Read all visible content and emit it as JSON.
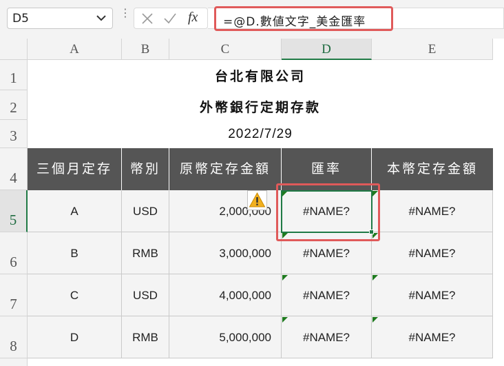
{
  "namebox": {
    "value": "D5"
  },
  "formula_bar": {
    "fx_label": "fx",
    "formula": "=@D.數値文字_美金匯率"
  },
  "columns": [
    "A",
    "B",
    "C",
    "D",
    "E"
  ],
  "rows": [
    "1",
    "2",
    "3",
    "4",
    "5",
    "6",
    "7",
    "8"
  ],
  "sheet": {
    "title1": "台北有限公司",
    "title2": "外幣銀行定期存款",
    "date": "2022/7/29",
    "headers": [
      "三個月定存",
      "幣別",
      "原幣定存金額",
      "匯率",
      "本幣定存金額"
    ],
    "data": [
      [
        "A",
        "USD",
        "2,000,000",
        "#NAME?",
        "#NAME?"
      ],
      [
        "B",
        "RMB",
        "3,000,000",
        "#NAME?",
        "#NAME?"
      ],
      [
        "C",
        "USD",
        "4,000,000",
        "#NAME?",
        "#NAME?"
      ],
      [
        "D",
        "RMB",
        "5,000,000",
        "#NAME?",
        "#NAME?"
      ]
    ]
  },
  "colors": {
    "header_fill": "#555555",
    "selection": "#1f7a45",
    "highlight": "#e05a5a"
  }
}
